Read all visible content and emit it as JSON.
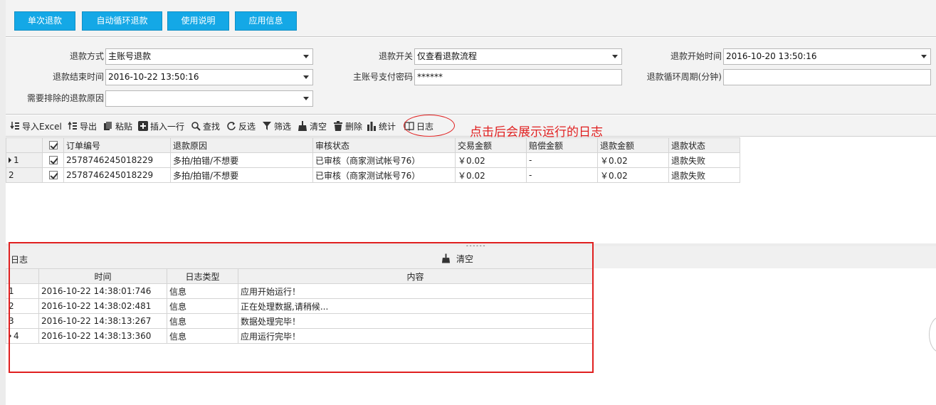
{
  "top_buttons": [
    "单次退款",
    "自动循环退款",
    "使用说明",
    "应用信息"
  ],
  "form": {
    "refund_method": {
      "label": "退款方式",
      "value": "主账号退款"
    },
    "refund_switch": {
      "label": "退款开关",
      "value": "仅查看退款流程"
    },
    "refund_start_time": {
      "label": "退款开始时间",
      "value": "2016-10-20 13:50:16"
    },
    "refund_end_time": {
      "label": "退款结束时间",
      "value": "2016-10-22 13:50:16"
    },
    "pay_password": {
      "label": "主账号支付密码",
      "value": "******"
    },
    "loop_period": {
      "label": "退款循环周期(分钟)",
      "value": ""
    },
    "exclude_reason": {
      "label": "需要排除的退款原因",
      "value": ""
    }
  },
  "toolbar": {
    "import_excel": "导入Excel",
    "export": "导出",
    "paste": "粘贴",
    "insert_row": "插入一行",
    "find": "查找",
    "invert": "反选",
    "filter": "筛选",
    "clear": "清空",
    "delete": "删除",
    "stats": "统计",
    "log": "日志"
  },
  "annotation": "点击后会展示运行的日志",
  "orders": {
    "columns": [
      "订单编号",
      "退款原因",
      "审核状态",
      "交易金额",
      "赔偿金额",
      "退款金额",
      "退款状态"
    ],
    "rows": [
      {
        "index": "1",
        "order_no": "2578746245018229",
        "reason": "多拍/拍错/不想要",
        "audit": "已审核（商家测试帐号76）",
        "trade_amount": "￥0.02",
        "compensation": "-",
        "refund_amount": "￥0.02",
        "refund_status": "退款失败"
      },
      {
        "index": "2",
        "order_no": "2578746245018229",
        "reason": "多拍/拍错/不想要",
        "audit": "已审核（商家测试帐号76）",
        "trade_amount": "￥0.02",
        "compensation": "-",
        "refund_amount": "￥0.02",
        "refund_status": "退款失败"
      }
    ]
  },
  "log": {
    "title": "日志",
    "clear_label": "清空",
    "columns": [
      "时间",
      "日志类型",
      "内容"
    ],
    "rows": [
      {
        "index": "1",
        "time": "2016-10-22 14:38:01:746",
        "type": "信息",
        "content": "应用开始运行！"
      },
      {
        "index": "2",
        "time": "2016-10-22 14:38:02:481",
        "type": "信息",
        "content": "正在处理数据,请稍候..."
      },
      {
        "index": "3",
        "time": "2016-10-22 14:38:13:267",
        "type": "信息",
        "content": "数据处理完毕！"
      },
      {
        "index": "4",
        "time": "2016-10-22 14:38:13:360",
        "type": "信息",
        "content": "应用运行完毕！"
      }
    ]
  },
  "colors": {
    "accent_button": "#14a8e6",
    "annotation_red": "#e02020"
  }
}
